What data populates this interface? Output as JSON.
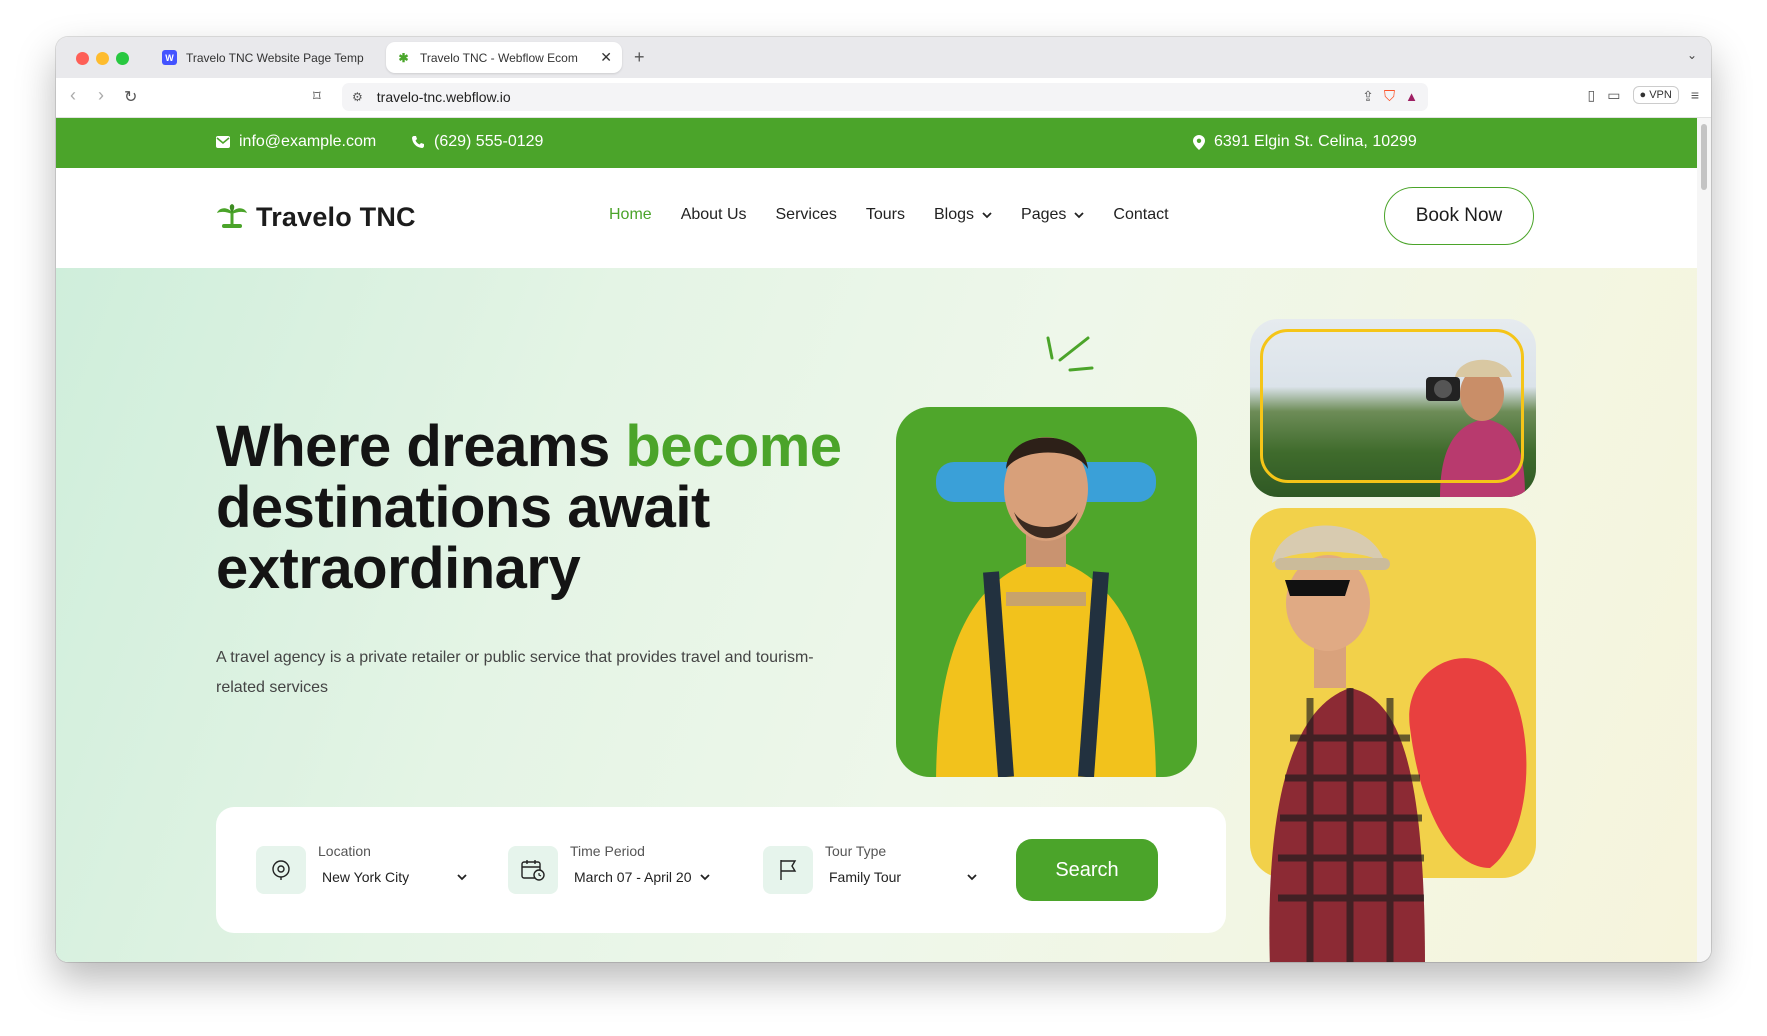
{
  "browser": {
    "tabs": [
      {
        "title": "Travelo TNC Website Page Templ",
        "favicon": "webflow-icon",
        "active": false
      },
      {
        "title": "Travelo TNC - Webflow Ecom",
        "favicon": "travelo-icon",
        "active": true
      }
    ],
    "url": "travelo-tnc.webflow.io",
    "vpn_label": "VPN"
  },
  "topbar": {
    "email": "info@example.com",
    "phone": "(629) 555-0129",
    "address": "6391 Elgin St. Celina, 10299"
  },
  "header": {
    "logo_text": "Travelo TNC",
    "nav": [
      "Home",
      "About Us",
      "Services",
      "Tours",
      "Blogs",
      "Pages",
      "Contact"
    ],
    "book_label": "Book Now"
  },
  "hero": {
    "title_part1": "Where dreams ",
    "title_highlight": "become",
    "title_part2": "destinations await extraordinary",
    "description": "A travel agency is a private retailer or public service that provides travel and tourism-related services"
  },
  "search": {
    "location_label": "Location",
    "location_value": "New York City",
    "time_label": "Time Period",
    "time_value": "March 07 - April 20",
    "tour_label": "Tour Type",
    "tour_value": "Family Tour",
    "button_label": "Search"
  },
  "colors": {
    "brand_green": "#4ba42a",
    "accent_yellow": "#f2d14a"
  }
}
